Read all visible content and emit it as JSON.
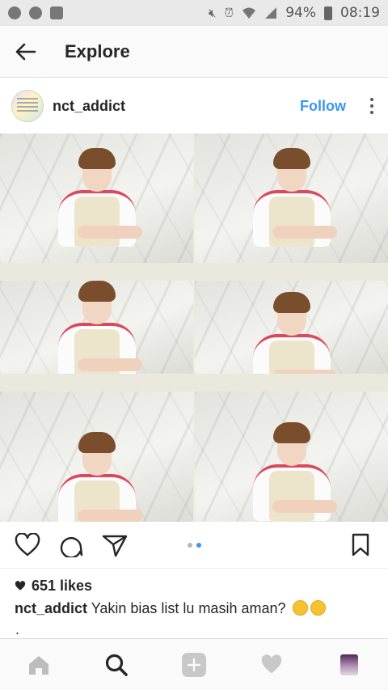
{
  "status_bar": {
    "battery": "94%",
    "time": "08:19",
    "left_icons": [
      "app-notification-icon",
      "snapchat-icon",
      "gallery-icon"
    ],
    "right_icons": [
      "mute-icon",
      "alarm-icon",
      "wifi-icon",
      "signal-icon",
      "battery-icon"
    ]
  },
  "header": {
    "title": "Explore",
    "back_icon": "arrow-left-icon"
  },
  "post": {
    "username": "nct_addict",
    "follow_label": "Follow",
    "more_icon": "more-vertical-icon",
    "carousel_index": 1,
    "carousel_count": 2,
    "likes": "651 likes",
    "caption_user": "nct_addict",
    "caption_text": "Yakin bias list lu masih aman?",
    "caption_more": "."
  },
  "actions": [
    "heart-icon",
    "comment-icon",
    "share-icon",
    "bookmark-icon"
  ],
  "bottom_nav": [
    "home-icon",
    "search-icon",
    "add-icon",
    "activity-heart-icon",
    "profile-avatar"
  ],
  "colors": {
    "accent": "#3897f0",
    "text": "#262626",
    "status_bar_bg": "#e9e9e9",
    "bar_bg": "#fafafa"
  }
}
